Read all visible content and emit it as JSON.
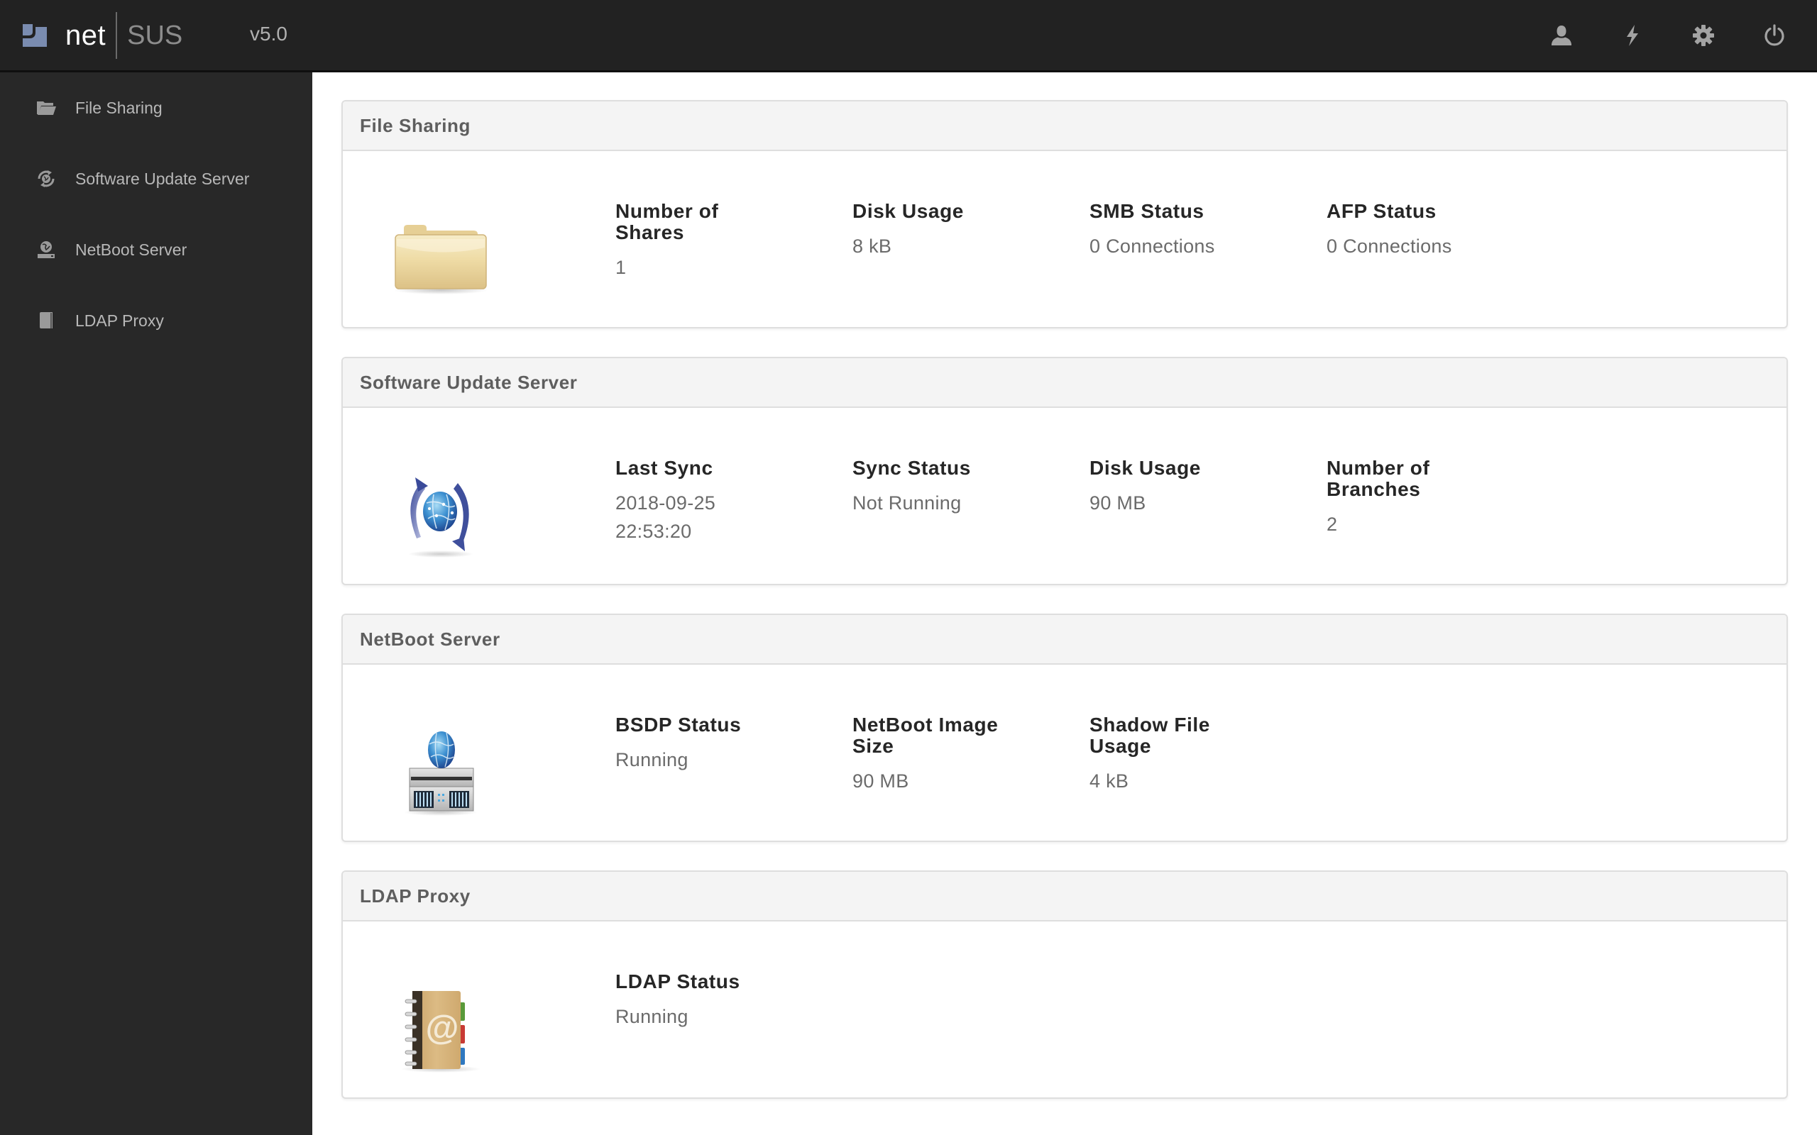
{
  "header": {
    "brand_primary": "net",
    "brand_secondary": "SUS",
    "version": "v5.0",
    "icons": [
      {
        "name": "user-icon",
        "label": "User"
      },
      {
        "name": "lightning-icon",
        "label": "Quick actions"
      },
      {
        "name": "gear-icon",
        "label": "Settings"
      },
      {
        "name": "power-icon",
        "label": "Log out"
      }
    ]
  },
  "sidebar": {
    "items": [
      {
        "label": "File Sharing",
        "icon": "folder-open-icon"
      },
      {
        "label": "Software Update Server",
        "icon": "sync-globe-icon"
      },
      {
        "label": "NetBoot Server",
        "icon": "netboot-globe-icon"
      },
      {
        "label": "LDAP Proxy",
        "icon": "book-icon"
      }
    ]
  },
  "cards": {
    "file_sharing": {
      "title": "File Sharing",
      "icon": "folder-icon",
      "metrics": [
        {
          "label": "Number of Shares",
          "value": "1"
        },
        {
          "label": "Disk Usage",
          "value": "8 kB"
        },
        {
          "label": "SMB Status",
          "value": "0 Connections"
        },
        {
          "label": "AFP Status",
          "value": "0 Connections"
        }
      ]
    },
    "software_update": {
      "title": "Software Update Server",
      "icon": "software-update-icon",
      "metrics": [
        {
          "label": "Last Sync",
          "value": "2018-09-25 22:53:20"
        },
        {
          "label": "Sync Status",
          "value": "Not Running"
        },
        {
          "label": "Disk Usage",
          "value": "90 MB"
        },
        {
          "label": "Number of Branches",
          "value": "2"
        }
      ]
    },
    "netboot": {
      "title": "NetBoot Server",
      "icon": "netboot-server-icon",
      "metrics": [
        {
          "label": "BSDP Status",
          "value": "Running"
        },
        {
          "label": "NetBoot Image Size",
          "value": "90 MB"
        },
        {
          "label": "Shadow File Usage",
          "value": "4 kB"
        }
      ]
    },
    "ldap": {
      "title": "LDAP Proxy",
      "icon": "address-book-icon",
      "metrics": [
        {
          "label": "LDAP Status",
          "value": "Running"
        }
      ]
    }
  },
  "colors": {
    "topbar_bg": "#222222",
    "sidebar_bg": "#282828",
    "logo_blue": "#7a8cb0",
    "card_header_bg": "#f4f4f4"
  }
}
